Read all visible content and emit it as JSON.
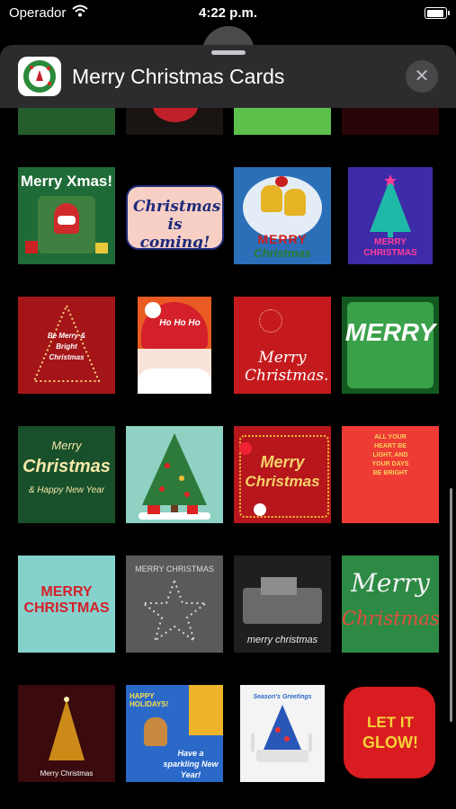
{
  "status_bar": {
    "carrier": "Operador",
    "time": "4:22 p.m.",
    "battery_level": 0.9
  },
  "header": {
    "title": "Merry Christmas Cards",
    "close_icon": "close-icon"
  },
  "cards": {
    "row2": [
      "Merry Xmas!",
      "Christmas is coming!",
      "MERRY",
      "Christmas",
      "MERRY CHRISTMAS"
    ],
    "row3": [
      "Be Merry & Bright Christmas",
      "Ho Ho Ho",
      "Merry Christmas.",
      "MERRY"
    ],
    "row4": [
      "Merry",
      "Christmas",
      "& Happy New Year",
      "Merry",
      "Christmas",
      "All your heart be light, and your days be bright"
    ],
    "row5": [
      "MERRY",
      "CHRISTMAS",
      "MERRY CHRISTMAS",
      "merry christmas",
      "Merry",
      "Christmas"
    ],
    "row6": [
      "Merry Christmas",
      "HAPPY HOLIDAYS!",
      "Have a sparkling New Year!",
      "Season's Greetings",
      "LET IT",
      "GLOW!"
    ]
  }
}
